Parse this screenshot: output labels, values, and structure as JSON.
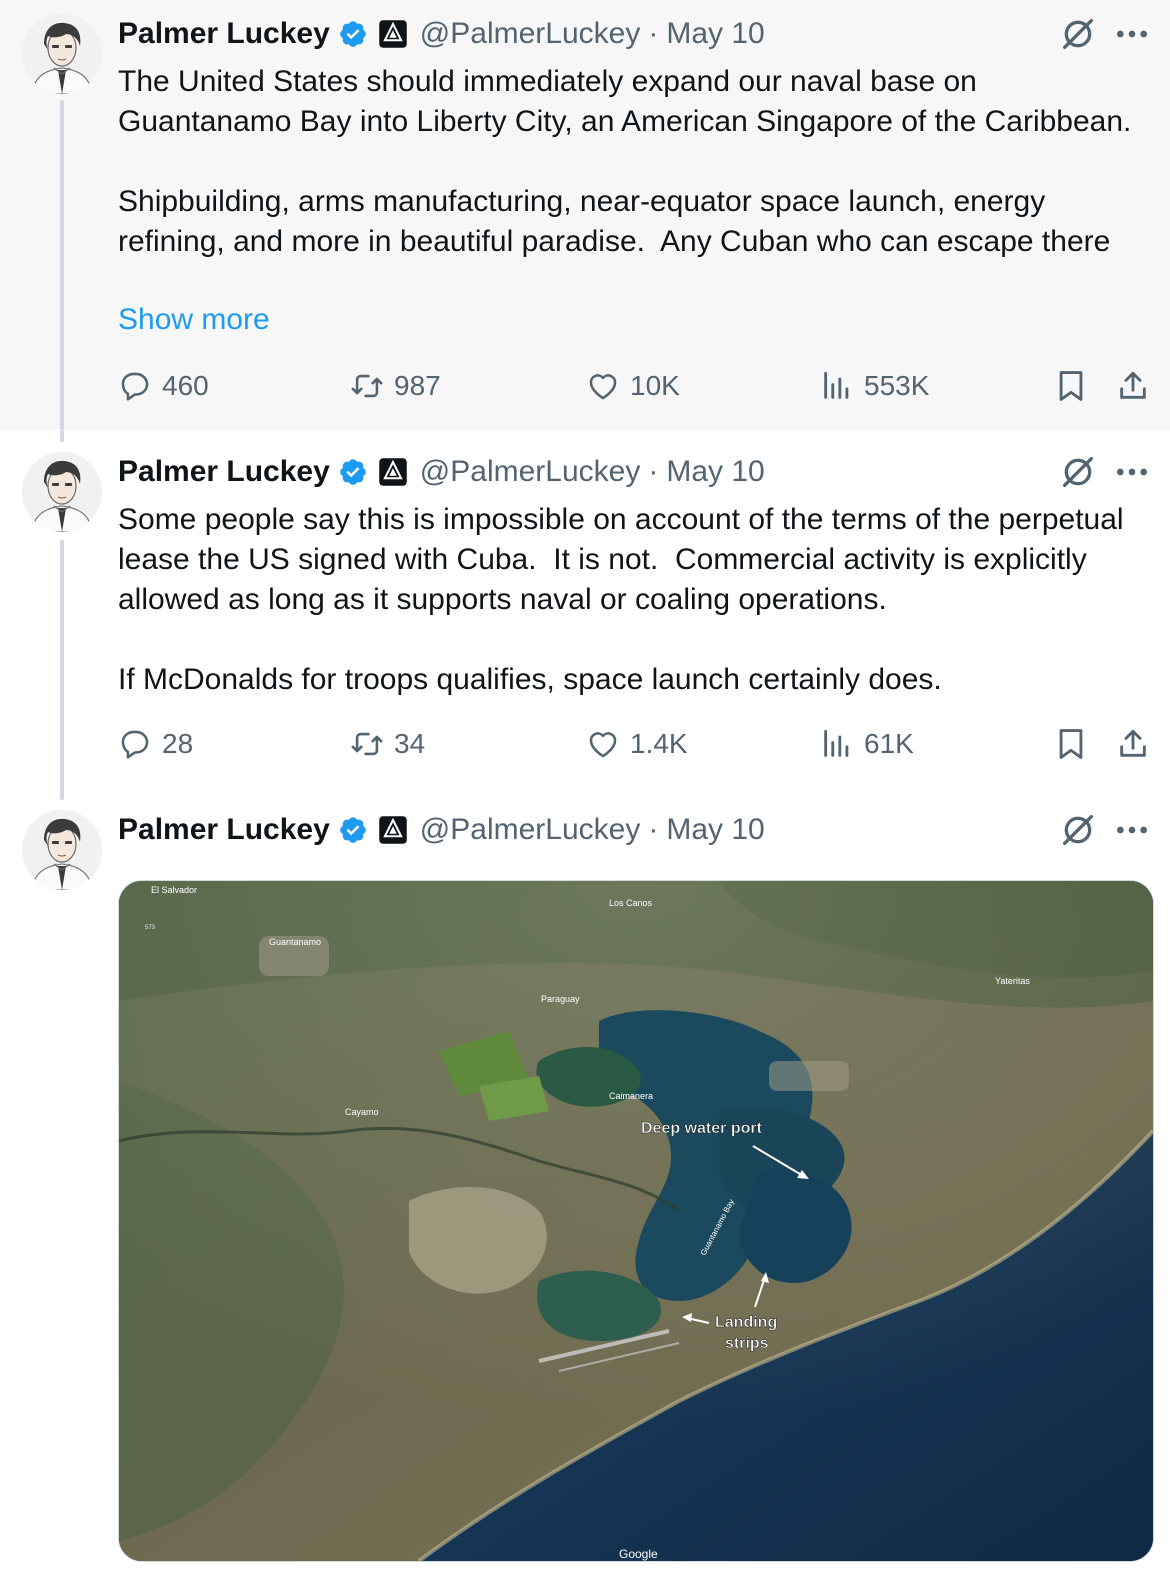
{
  "tweets": [
    {
      "author": "Palmer Luckey",
      "handle": "@PalmerLuckey",
      "separator": "·",
      "date": "May 10",
      "paragraphs": [
        "The United States should immediately expand our naval base on Guantanamo Bay into Liberty City, an American Singapore of the Caribbean.",
        "Shipbuilding, arms manufacturing, near-equator space launch, energy refining, and more in beautiful paradise.  Any Cuban who can escape there"
      ],
      "show_more": "Show more",
      "replies": "460",
      "retweets": "987",
      "likes": "10K",
      "views": "553K"
    },
    {
      "author": "Palmer Luckey",
      "handle": "@PalmerLuckey",
      "separator": "·",
      "date": "May 10",
      "paragraphs": [
        "Some people say this is impossible on account of the terms of the perpetual lease the US signed with Cuba.  It is not.  Commercial activity is explicitly allowed as long as it supports naval or coaling operations.",
        "If McDonalds for troops qualifies, space launch certainly does."
      ],
      "replies": "28",
      "retweets": "34",
      "likes": "1.4K",
      "views": "61K"
    },
    {
      "author": "Palmer Luckey",
      "handle": "@PalmerLuckey",
      "separator": "·",
      "date": "May 10"
    }
  ],
  "map": {
    "labels": {
      "el_salvador": "El Salvador",
      "road": "573",
      "guantanamo": "Guantanamo",
      "los_canos": "Los Canos",
      "paraguay": "Paraguay",
      "yateritas": "Yateritas",
      "caimanera": "Caimanera",
      "cayamo": "Cayamo",
      "bay": "Guantanamo Bay",
      "google": "Google"
    },
    "annotations": {
      "deep_water_port": "Deep water port",
      "landing_line1": "Landing",
      "landing_line2": "strips"
    }
  },
  "colors": {
    "accent": "#1d9bf0",
    "secondary_text": "#536471",
    "thread_line": "#cfd9de",
    "highlight_bg": "#f7f7f7"
  }
}
